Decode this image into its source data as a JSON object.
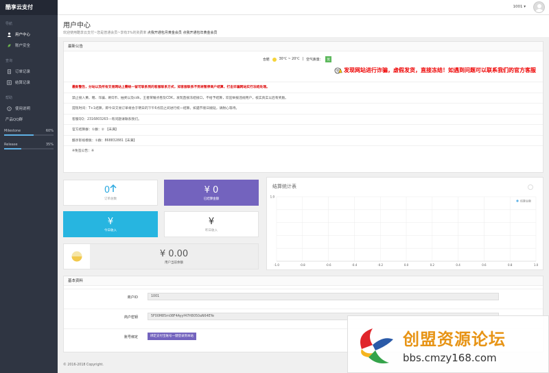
{
  "app": {
    "brand": "酷享云支付"
  },
  "topbar": {
    "user_id": "1001 ▾"
  },
  "sidebar": {
    "sections": [
      {
        "label": "导航",
        "items": [
          {
            "label": "用户中心",
            "icon": "user-icon",
            "active": true
          },
          {
            "label": "账户安全",
            "icon": "leaf-icon",
            "active": false
          }
        ]
      },
      {
        "label": "查询",
        "items": [
          {
            "label": "订单记录",
            "icon": "document-icon",
            "active": false
          },
          {
            "label": "结算记录",
            "icon": "list-icon",
            "active": false
          }
        ]
      },
      {
        "label": "帮助",
        "items": [
          {
            "label": "使用说明",
            "icon": "help-icon",
            "active": false
          },
          {
            "label": "产品QQ群",
            "icon": "",
            "active": false
          }
        ]
      }
    ],
    "progress": [
      {
        "label": "Milestone",
        "value": "60%",
        "fraction": 0.6
      },
      {
        "label": "Release",
        "value": "35%",
        "fraction": 0.35
      }
    ]
  },
  "header": {
    "title": "用户中心",
    "subtitle": "欢迎使用酷享云支付~您是普通会员~享有3%的资费率",
    "link1": "点我开通包月黄金会员",
    "link2": "点我开通包年黄金会员"
  },
  "announcement": {
    "title": "最新公告",
    "weather": {
      "city": "合肥",
      "temp": "30℃ ~ 20℃",
      "aq_label": "空气质量：",
      "aq": "优"
    },
    "warning": "发现网站进行诈骗，虚假发货，直接冻结！如遇到问题可以联系我们的官方客服",
    "lines": [
      "最新警告，分站以及所有交易网站上需统一留可联系到的客服联系方式，如客服联系不到将暂停商户结算，打击诈骗网站实行冻结处理。",
      "禁止接入黄、赌、诈骗、刷Q币、抽奖以及cdk，王者荣耀点卷及CDK，发现直接冻结接口，不给予结算，欢迎举报违规用户，核实真实以后有奖励。",
      "提现时间：T+1结算，即今日交易订单将会于明日的下午6点前之间进行统一结算。如遇节假日顺延，请耐心等待。",
      "客服QQ：2316803263---有问题请联系我们。",
      "官方结算群：①群：② 【未满】",
      "酷享影视模板：①群：868832881【未满】",
      "※免签公告：※"
    ]
  },
  "stats": {
    "orders": {
      "value": "0",
      "label": "订单总数"
    },
    "settled": {
      "value": "¥ 0",
      "label": "已结算金额"
    },
    "today": {
      "value": "¥",
      "label": "今日收入"
    },
    "yesterday": {
      "value": "¥",
      "label": "昨日收入"
    },
    "balance": {
      "value": "¥ 0.00",
      "label": "用户当前余额"
    }
  },
  "chart_data": {
    "type": "line",
    "title": "结算统计表",
    "legend": [
      "结算金额"
    ],
    "legend_position": "top-right",
    "x": [
      -1.0,
      -0.8,
      -0.6,
      -0.4,
      -0.2,
      0.0,
      0.2,
      0.4,
      0.6,
      0.8,
      1.0
    ],
    "x_tick_labels": [
      "-1.0",
      "-0.8",
      "-0.6",
      "-0.4",
      "-0.2",
      "0.0",
      "0.2",
      "0.4",
      "0.6",
      "0.8",
      "1.0"
    ],
    "y_ticks": [
      0,
      0.2,
      0.4,
      0.6,
      0.8,
      1.0
    ],
    "y_tick_labels": [
      "",
      "",
      "",
      "",
      "",
      "1.0"
    ],
    "xlim": [
      -1.0,
      1.0
    ],
    "ylim": [
      0,
      1.0
    ],
    "grid": true,
    "series": [
      {
        "name": "结算金额",
        "values": []
      }
    ],
    "legend_color": "#5fb2e6"
  },
  "basic": {
    "title": "基本资料",
    "fields": [
      {
        "label": "商户ID",
        "value": "1001",
        "type": "input"
      },
      {
        "label": "商户密钥",
        "value": "5F00M85m08F4Ayyf47H8050aN64EYe",
        "type": "input"
      },
      {
        "label": "账号绑定",
        "value": "绑定支付宝账号一键登录到本站",
        "type": "button"
      }
    ]
  },
  "footer": {
    "text": "© 2016-2018 Copyright."
  },
  "watermark": {
    "title": "创盟资源论坛",
    "url": "bbs.cmzy168.com"
  }
}
